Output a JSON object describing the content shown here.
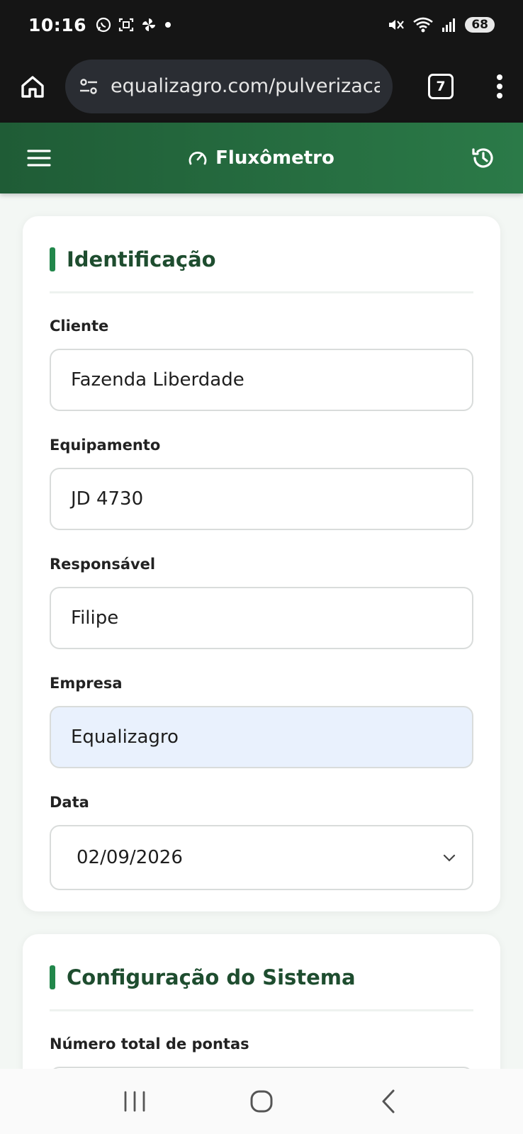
{
  "status_bar": {
    "time": "10:16",
    "battery": "68",
    "icons_left": [
      "whatsapp-icon",
      "screenshot-icon",
      "pinwheel-icon",
      "dot-icon"
    ],
    "icons_right": [
      "mute-icon",
      "wifi-icon",
      "signal-icon"
    ]
  },
  "browser": {
    "url": "equalizagro.com/pulverizaca",
    "tab_count": "7"
  },
  "header": {
    "title": "Fluxômetro"
  },
  "identificacao": {
    "title": "Identificação",
    "fields": [
      {
        "label": "Cliente",
        "value": "Fazenda Liberdade"
      },
      {
        "label": "Equipamento",
        "value": "JD 4730"
      },
      {
        "label": "Responsável",
        "value": "Filipe"
      },
      {
        "label": "Empresa",
        "value": "Equalizagro"
      },
      {
        "label": "Data",
        "value": "02/09/2026"
      }
    ]
  },
  "configuracao": {
    "title": "Configuração do Sistema",
    "fields": [
      {
        "label": "Número total de pontas",
        "value": ""
      }
    ]
  },
  "colors": {
    "header_start": "#1f5c36",
    "header_end": "#2b7a48",
    "accent_bar": "#22874b",
    "section_title": "#1e4d2f",
    "autofill_bg": "#e9f1fd"
  }
}
